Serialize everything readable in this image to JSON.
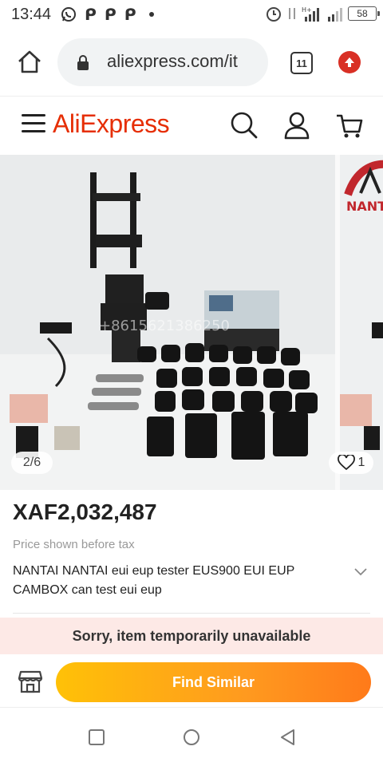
{
  "status_bar": {
    "time": "13:44",
    "notification_icons": [
      "whatsapp-icon",
      "p-icon",
      "p-icon",
      "p-icon"
    ],
    "battery": "58"
  },
  "browser": {
    "url": "aliexpress.com/it",
    "tab_count": "11"
  },
  "header": {
    "logo": "AliExpress",
    "icons": [
      "menu-icon",
      "search-icon",
      "account-icon",
      "cart-icon"
    ]
  },
  "gallery": {
    "counter": "2/6",
    "wishlist_count": "1",
    "watermark": "+8615621386250",
    "next_image_logo": "NANTAI"
  },
  "product": {
    "price": "XAF2,032,487",
    "tax_note": "Price shown before tax",
    "title": "NANTAI NANTAI eui eup tester EUS900 EUI EUP CAMBOX can test eui eup"
  },
  "notice": {
    "text": "Sorry, item temporarily unavailable"
  },
  "actions": {
    "find_similar": "Find Similar"
  },
  "colors": {
    "brand": "#e62e04",
    "button_gradient_start": "#ffc107",
    "button_gradient_end": "#ff7a1a",
    "notice_bg": "#fde9e6"
  }
}
